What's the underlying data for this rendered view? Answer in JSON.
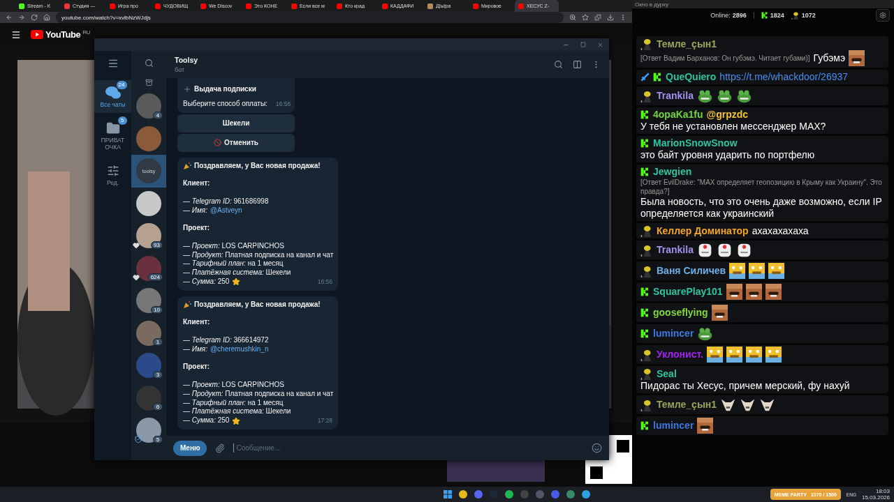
{
  "browser": {
    "tabs": [
      {
        "title": "Stream - K",
        "kind": "kick",
        "selected": false
      },
      {
        "title": "Студия —",
        "kind": "studio",
        "selected": false
      },
      {
        "title": "Игра про",
        "kind": "video",
        "selected": false
      },
      {
        "title": "ЧУДОВИЩ",
        "kind": "video",
        "selected": false
      },
      {
        "title": "We Discov",
        "kind": "video",
        "selected": false
      },
      {
        "title": "Это КОНЕ",
        "kind": "video",
        "selected": false
      },
      {
        "title": "Если все м",
        "kind": "video",
        "selected": false
      },
      {
        "title": "Кто крад",
        "kind": "video",
        "selected": false
      },
      {
        "title": "КАДДАФИ",
        "kind": "video",
        "selected": false
      },
      {
        "title": "Д[ы]ра",
        "kind": "person",
        "selected": false
      },
      {
        "title": "Мировое",
        "kind": "video",
        "selected": false
      },
      {
        "title": "ХЕСУС Z-",
        "kind": "video",
        "selected": true
      }
    ],
    "url": "youtube.com/watch?v=xvlbNzWJdjs"
  },
  "youtube": {
    "logo": "YouTube",
    "region": "RU"
  },
  "telegram": {
    "folders": [
      {
        "kind": "chats",
        "label": "Все чаты",
        "count": "24",
        "selected": true
      },
      {
        "kind": "folder",
        "label": "ПРИВАТ ОЧКА",
        "count": "5",
        "selected": false
      },
      {
        "kind": "edit",
        "label": "Ред.",
        "selected": false
      }
    ],
    "chats": [
      {
        "count": "4",
        "selected": false
      },
      {
        "selected": false
      },
      {
        "avatar_text": "toolsy",
        "selected": true
      },
      {
        "selected": false
      },
      {
        "count": "93",
        "reaction": true,
        "selected": false
      },
      {
        "count": "624",
        "reaction": true,
        "selected": false
      },
      {
        "count": "10",
        "selected": false
      },
      {
        "count": "1",
        "selected": false
      },
      {
        "count": "3",
        "selected": false
      },
      {
        "count": "6",
        "selected": false
      },
      {
        "count": "5",
        "verified": true,
        "selected": false
      }
    ],
    "header": {
      "title": "Toolsy",
      "subtitle": "бот"
    },
    "menu_message": {
      "heading": "Выдача подписки",
      "prompt": "Выберите способ оплаты:",
      "time": "16:56",
      "buttons": [
        {
          "label": "Шекели",
          "kind": "plain"
        },
        {
          "label": "Отменить",
          "kind": "cancel"
        }
      ]
    },
    "sales": [
      {
        "title": "Поздравляем, у Вас новая продажа!",
        "client_heading": "Клиент:",
        "client_lines": [
          {
            "text": "— *Telegram ID:* 961686998"
          },
          {
            "text": "— *Имя:*",
            "link": "@Astveyn"
          }
        ],
        "project_heading": "Проект:",
        "project_lines": [
          {
            "text": "— *Проект:* LOS CARPINCHOS"
          },
          {
            "text": "— *Продукт:* Платная подписка на канал и чат"
          },
          {
            "text": "— *Тарифный план:* на 1 месяц"
          },
          {
            "text": "— *Платёжная система:* Шекели"
          },
          {
            "text": "— *Сумма:* 250",
            "star": true
          }
        ],
        "time": "16:56"
      },
      {
        "title": "Поздравляем, у Вас новая продажа!",
        "client_heading": "Клиент:",
        "client_lines": [
          {
            "text": "— *Telegram ID:* 366614972"
          },
          {
            "text": "— *Имя:*",
            "link": "@cheremushkin_n"
          }
        ],
        "project_heading": "Проект:",
        "project_lines": [
          {
            "text": "— *Проект:* LOS CARPINCHOS"
          },
          {
            "text": "— *Продукт:* Платная подписка на канал и чат"
          },
          {
            "text": "— *Тарифный план:* на 1 месяц"
          },
          {
            "text": "— *Платёжная система:* Шекели"
          },
          {
            "text": "— *Сумма:* 250",
            "star": true
          }
        ],
        "time": "17:28"
      }
    ],
    "input": {
      "menu": "Меню",
      "placeholder": "Сообщение..."
    }
  },
  "stream_chat": {
    "window_title": "Окно в дурку",
    "online_label": "Online:",
    "online": "2896",
    "kick_count": "1824",
    "other_count": "1072",
    "messages": [
      {
        "badges": [
          {
            "kind": "helmet"
          }
        ],
        "user": "Темле_çын1",
        "color": "#9da35a",
        "reply": "[Ответ Вадим Барханов: Он губэмэ. Читает губами)]",
        "text": "Губэмэ",
        "emotes": [
          {
            "kind": "laughing"
          }
        ]
      },
      {
        "badges": [
          {
            "kind": "sword"
          },
          {
            "kind": "kick"
          }
        ],
        "user": "QueQuiero",
        "color": "#2ec4a0",
        "link": "https://t.me/whackdoor/26937"
      },
      {
        "badges": [
          {
            "kind": "helmet"
          }
        ],
        "user": "Trankila",
        "color": "#a68ef0",
        "emotes": [
          {
            "kind": "frog"
          },
          {
            "kind": "frog"
          },
          {
            "kind": "frog"
          }
        ]
      },
      {
        "badges": [
          {
            "kind": "kick"
          }
        ],
        "user": "4opaKa1fu",
        "color": "#72d43c",
        "mention": "@grpzdc",
        "text": "У тебя не установлен мессенджер MAX?"
      },
      {
        "badges": [
          {
            "kind": "kick"
          }
        ],
        "user": "MarionSnowSnow",
        "color": "#2ec4a0",
        "text": "это байт уровня ударить по портфелю"
      },
      {
        "badges": [
          {
            "kind": "kick"
          }
        ],
        "user": "Jewgien",
        "color": "#2ec4a0",
        "reply": "[Ответ EvilDrake: \"MAX определяет геопозицию в Крыму как Украину\". Это правда?]",
        "text": "Была новость, что это очень даже возможно, если IP определяется как украинский"
      },
      {
        "badges": [
          {
            "kind": "helmet"
          }
        ],
        "user": "Келлер Доминатор",
        "color": "#f2a622",
        "text": "ахахахахаха"
      },
      {
        "badges": [
          {
            "kind": "helmet"
          }
        ],
        "user": "Trankila",
        "color": "#a68ef0",
        "emotes": [
          {
            "kind": "nurse"
          },
          {
            "kind": "nurse"
          },
          {
            "kind": "nurse"
          }
        ]
      },
      {
        "badges": [
          {
            "kind": "helmet"
          }
        ],
        "user": "Ваня Силичев",
        "color": "#6cb0ea",
        "emotes": [
          {
            "kind": "crying"
          },
          {
            "kind": "crying"
          },
          {
            "kind": "crying"
          }
        ]
      },
      {
        "badges": [
          {
            "kind": "kick"
          }
        ],
        "user": "SquarePlay101",
        "color": "#2ec4a0",
        "emotes": [
          {
            "kind": "laughing"
          },
          {
            "kind": "laughing"
          },
          {
            "kind": "laughing"
          }
        ]
      },
      {
        "badges": [
          {
            "kind": "kick"
          }
        ],
        "user": "gooseflying",
        "color": "#7fd93c",
        "emotes": [
          {
            "kind": "laughing"
          }
        ]
      },
      {
        "badges": [
          {
            "kind": "kick"
          }
        ],
        "user": "lumincer",
        "color": "#3a7ae0",
        "emotes": [
          {
            "kind": "frog"
          }
        ]
      },
      {
        "badges": [
          {
            "kind": "helmet"
          }
        ],
        "user": "Уклонист.",
        "color": "#a521f0",
        "emotes": [
          {
            "kind": "crying"
          },
          {
            "kind": "crying"
          },
          {
            "kind": "crying"
          },
          {
            "kind": "crying"
          }
        ]
      },
      {
        "badges": [
          {
            "kind": "helmet"
          }
        ],
        "user": "Seal",
        "color": "#2ec4a0",
        "text": "Пидорас ты Хесус, причем мерский, фу нахуй"
      },
      {
        "badges": [
          {
            "kind": "helmet"
          }
        ],
        "user": "Темле_çын1",
        "color": "#9da35a",
        "emotes": [
          {
            "kind": "dog"
          },
          {
            "kind": "dog"
          },
          {
            "kind": "dog"
          }
        ]
      },
      {
        "badges": [
          {
            "kind": "kick"
          }
        ],
        "user": "lumincer",
        "color": "#3a7ae0",
        "emotes": [
          {
            "kind": "laughing"
          }
        ]
      }
    ]
  },
  "taskbar": {
    "apps": [
      {
        "kind": "start"
      },
      {
        "kind": "chrome"
      },
      {
        "kind": "discord"
      },
      {
        "kind": "steam"
      },
      {
        "kind": "spotify"
      },
      {
        "kind": "obs"
      },
      {
        "kind": "app"
      },
      {
        "kind": "media"
      },
      {
        "kind": "snip"
      },
      {
        "kind": "telegram"
      }
    ],
    "widget": {
      "title": "MEME PARTY",
      "progress": "1075 / 1500"
    },
    "language": "ENG",
    "time": "18:03",
    "date": "15.03.2026"
  }
}
